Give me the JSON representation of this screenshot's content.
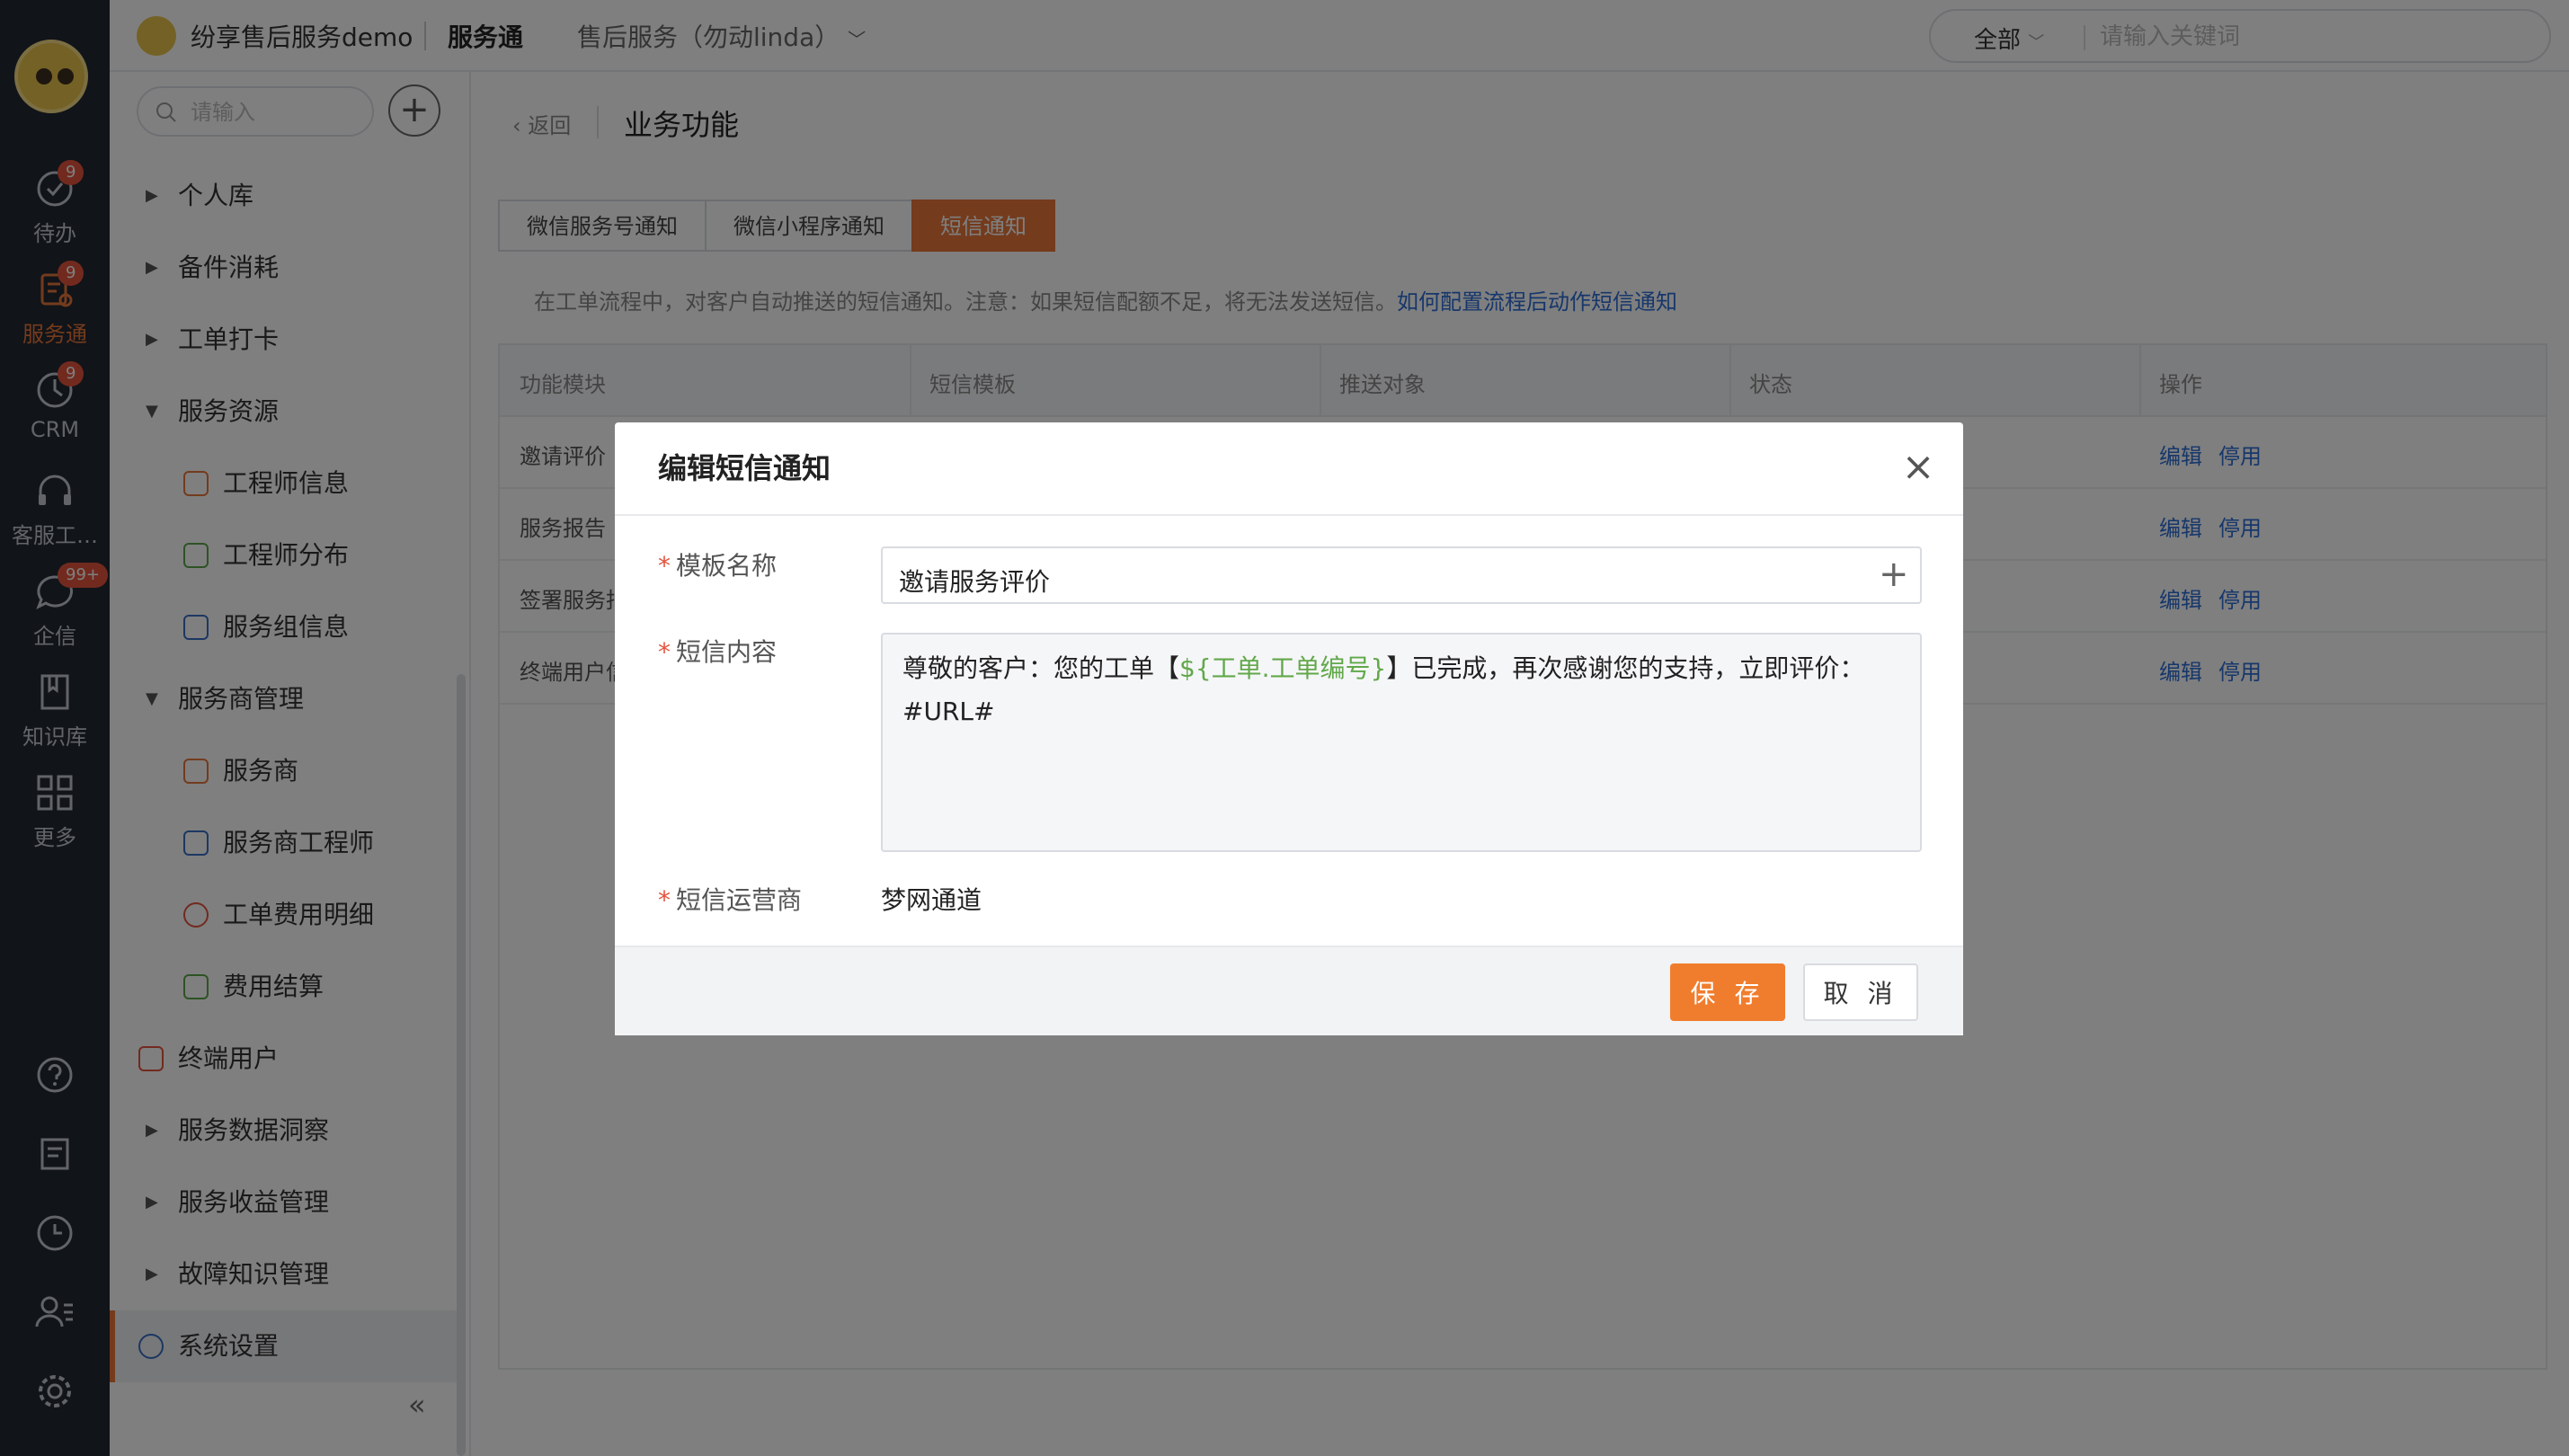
{
  "rail": {
    "items": [
      {
        "label": "待办",
        "badge": "9",
        "icon": "check-circle-icon"
      },
      {
        "label": "服务通",
        "badge": "9",
        "icon": "service-icon"
      },
      {
        "label": "CRM",
        "badge": "9",
        "icon": "crm-icon"
      },
      {
        "label": "客服工…",
        "badge": "",
        "icon": "headset-icon"
      },
      {
        "label": "企信",
        "badge": "99+",
        "icon": "chat-icon"
      },
      {
        "label": "知识库",
        "badge": "",
        "icon": "book-icon"
      },
      {
        "label": "更多",
        "badge": "",
        "icon": "grid-icon"
      }
    ],
    "active_color": "#e8763a"
  },
  "topbar": {
    "brand": "纷享售后服务demo",
    "module": "服务通",
    "context": "售后服务（勿动linda）",
    "search_scope": "全部",
    "search_placeholder": "请输入关键词"
  },
  "sidebar": {
    "search_placeholder": "请输入",
    "items": [
      {
        "label": "个人库"
      },
      {
        "label": "备件消耗"
      },
      {
        "label": "工单打卡"
      },
      {
        "label": "服务资源"
      },
      {
        "label": "工程师信息"
      },
      {
        "label": "工程师分布"
      },
      {
        "label": "服务组信息"
      },
      {
        "label": "服务商管理"
      },
      {
        "label": "服务商"
      },
      {
        "label": "服务商工程师"
      },
      {
        "label": "工单费用明细"
      },
      {
        "label": "费用结算"
      },
      {
        "label": "终端用户"
      },
      {
        "label": "服务数据洞察"
      },
      {
        "label": "服务收益管理"
      },
      {
        "label": "故障知识管理"
      },
      {
        "label": "系统设置"
      }
    ]
  },
  "main": {
    "back": "返回",
    "title": "业务功能",
    "tabs": [
      "微信服务号通知",
      "微信小程序通知",
      "短信通知"
    ],
    "hint": "在工单流程中，对客户自动推送的短信通知。注意：如果短信配额不足，将无法发送短信。",
    "hint_link": "如何配置流程后动作短信通知",
    "columns": [
      "功能模块",
      "短信模板",
      "推送对象",
      "状态",
      "操作"
    ],
    "rows": [
      {
        "module": "邀请评价",
        "edit": "编辑",
        "disable": "停用"
      },
      {
        "module": "服务报告",
        "edit": "编辑",
        "disable": "停用"
      },
      {
        "module": "签署服务报",
        "edit": "编辑",
        "disable": "停用"
      },
      {
        "module": "终端用户信",
        "edit": "编辑",
        "disable": "停用"
      }
    ]
  },
  "modal": {
    "title": "编辑短信通知",
    "template_name_label": "模板名称",
    "template_name_value": "邀请服务评价",
    "content_label": "短信内容",
    "content_before": "尊敬的客户：您的工单【",
    "content_var": "${工单.工单编号}",
    "content_after": "】已完成，再次感谢您的支持，立即评价：",
    "content_line2": "#URL#",
    "carrier_label": "短信运营商",
    "carrier_value": "梦网通道",
    "save": "保 存",
    "cancel": "取 消"
  }
}
